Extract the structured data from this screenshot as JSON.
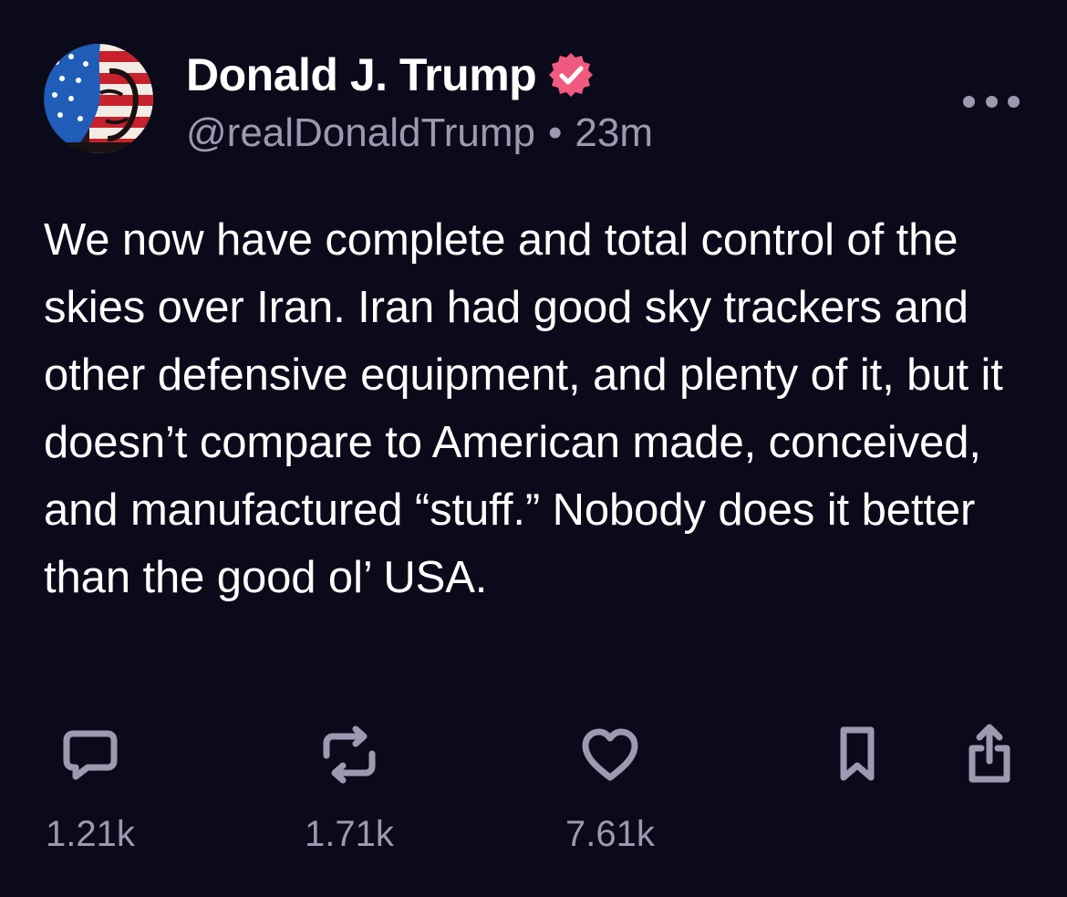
{
  "post": {
    "author": {
      "display_name": "Donald J. Trump",
      "handle": "@realDonaldTrump",
      "verified": true,
      "avatar_icon": "avatar-flag-face"
    },
    "separator": "•",
    "timestamp": "23m",
    "more_icon": "ellipsis-icon",
    "text": "We now have complete and total control of the skies over Iran. Iran had good sky trackers and other defensive equipment, and plenty of it, but it doesn’t compare to American made, conceived, and manufactured “stuff.” Nobody does it better than the good ol’ USA.",
    "actions": {
      "reply": {
        "icon": "comment-icon",
        "count": "1.21k"
      },
      "repost": {
        "icon": "repost-icon",
        "count": "1.71k"
      },
      "like": {
        "icon": "heart-icon",
        "count": "7.61k"
      },
      "bookmark": {
        "icon": "bookmark-icon"
      },
      "share": {
        "icon": "share-icon"
      }
    }
  },
  "colors": {
    "background": "#0b0a1a",
    "text_primary": "#ffffff",
    "text_secondary": "#9b9ab0",
    "verified_badge": "#f05a7e"
  }
}
